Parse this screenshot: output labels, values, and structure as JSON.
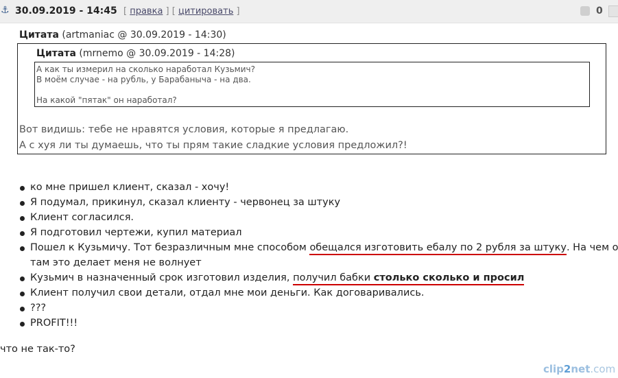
{
  "post": {
    "date": "30.09.2019 - 14:45",
    "actions": {
      "edit": "правка",
      "quote": "цитировать"
    },
    "vote_count": "0"
  },
  "quote_outer": {
    "title": "Цитата",
    "meta": "(artmaniac @ 30.09.2019 - 14:30)",
    "lines": [
      "Вот видишь: тебе не нравятся условия, которые я предлагаю.",
      "А с хуя ли ты думаешь, что ты прям такие сладкие условия предложил?!"
    ]
  },
  "quote_inner": {
    "title": "Цитата",
    "meta": "(mrnemo @ 30.09.2019 - 14:28)",
    "lines": [
      "А как ты измерил на сколько наработал Кузьмич?",
      "В моём случае - на рубль, у Барабаныча - на два.",
      "На какой \"пятак\" он наработал?"
    ]
  },
  "list": {
    "items": [
      "ко мне пришел клиент, сказал - хочу!",
      "Я подумал, прикинул, сказал клиенту - червонец за штуку",
      "Клиент согласился.",
      "Я подготовил чертежи, купил материал"
    ],
    "item5": {
      "before": "Пошел к Кузьмичу. Тот безразличным мне способом ",
      "underlined": "обещался изготовить ебалу по 2 рубля за штуку",
      "after": ". На чем он",
      "line2": "там это делает меня не волнует"
    },
    "item6": {
      "before": "Кузьмич в назначенный срок изготовил изделия, ",
      "underlined": "получил бабки ",
      "bold": "столько сколько и просил"
    },
    "items_tail": [
      "Клиент получил свои детали, отдал мне мои деньги. Как договаривались.",
      "???",
      "PROFIT!!!"
    ]
  },
  "footer": {
    "text": "что не так-то?"
  },
  "watermark": {
    "a": "clip",
    "b": "2",
    "c": "net",
    "d": ".com"
  }
}
